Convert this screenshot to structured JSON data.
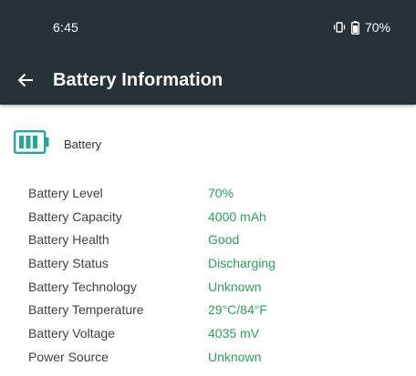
{
  "status_bar": {
    "time": "6:45",
    "battery_percent": "70%",
    "vibrate_icon": "vibrate-icon",
    "battery_icon": "battery-icon"
  },
  "app_bar": {
    "back_icon": "arrow-back-icon",
    "title": "Battery Information"
  },
  "battery_section": {
    "icon": "battery-full-icon",
    "label": "Battery"
  },
  "info": [
    {
      "label": "Battery Level",
      "value": "70%"
    },
    {
      "label": "Battery Capacity",
      "value": "4000 mAh"
    },
    {
      "label": "Battery Health",
      "value": "Good"
    },
    {
      "label": "Battery Status",
      "value": "Discharging"
    },
    {
      "label": "Battery Technology",
      "value": "Unknown"
    },
    {
      "label": "Battery Temperature",
      "value": "29°C/84°F"
    },
    {
      "label": "Battery Voltage",
      "value": "4035 mV"
    },
    {
      "label": "Power Source",
      "value": "Unknown"
    }
  ],
  "colors": {
    "toolbar": "#263238",
    "accent": "#2e9e5a",
    "icon_teal": "#26a69a"
  }
}
